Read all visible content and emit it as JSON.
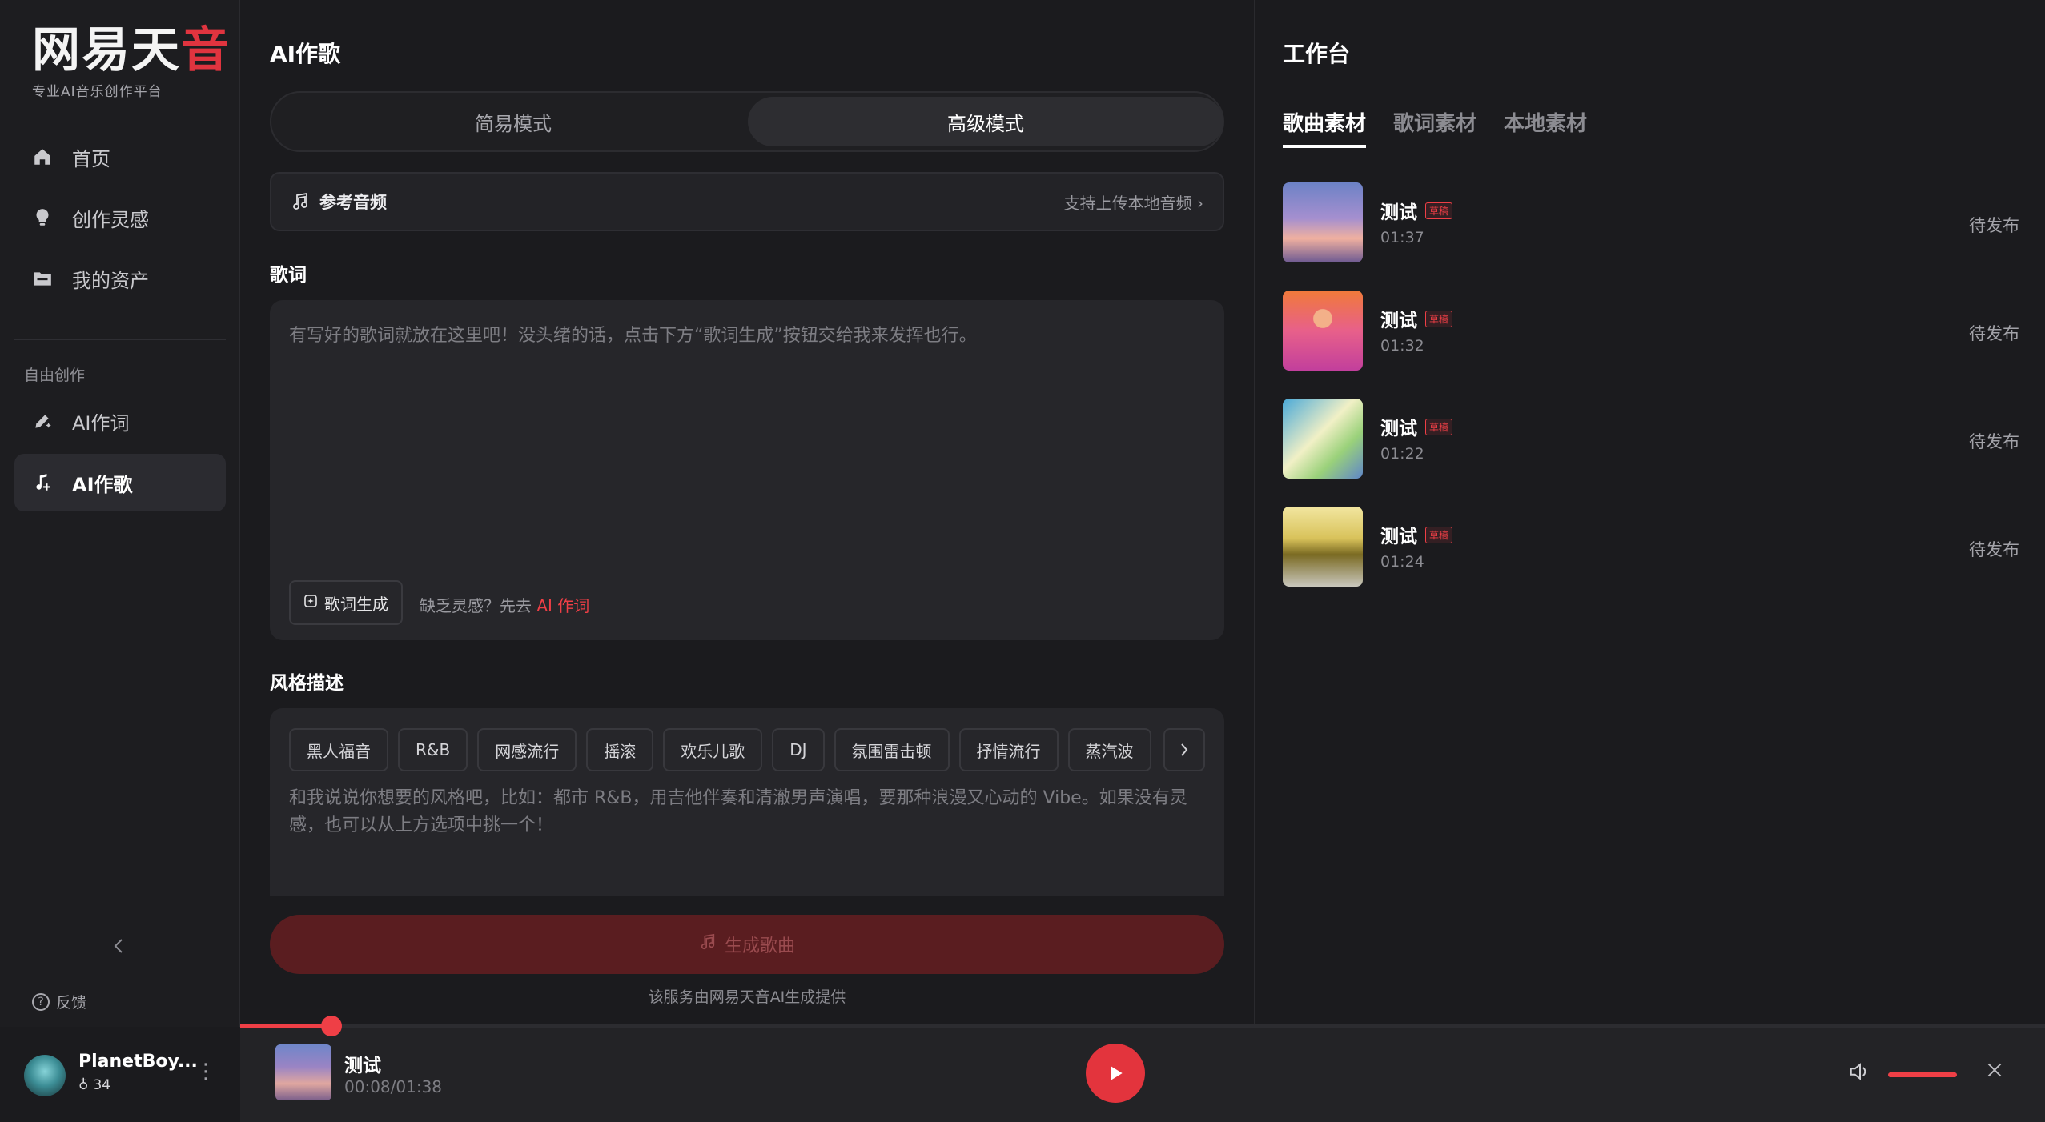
{
  "brand": {
    "logo_text": "网易天音",
    "tagline": "专业AI音乐创作平台"
  },
  "sidebar": {
    "nav": [
      {
        "label": "首页",
        "icon": "home-icon"
      },
      {
        "label": "创作灵感",
        "icon": "lightbulb-icon"
      },
      {
        "label": "我的资产",
        "icon": "folder-icon"
      }
    ],
    "section_label": "自由创作",
    "tools": [
      {
        "label": "AI作词",
        "icon": "pen-sparkle-icon",
        "active": false
      },
      {
        "label": "AI作歌",
        "icon": "music-note-plus-icon",
        "active": true
      }
    ],
    "feedback_label": "反馈",
    "user": {
      "name": "PlanetBoy...",
      "points": "34"
    }
  },
  "main": {
    "title": "AI作歌",
    "modes": [
      "简易模式",
      "高级模式"
    ],
    "active_mode": "高级模式",
    "reference_audio": {
      "label": "参考音频",
      "hint": "支持上传本地音频"
    },
    "lyrics": {
      "title": "歌词",
      "placeholder": "有写好的歌词就放在这里吧！没头绪的话，点击下方“歌词生成”按钮交给我来发挥也行。",
      "generate_label": "歌词生成",
      "hint_prefix": "缺乏灵感？先去",
      "hint_link": "AI 作词"
    },
    "style": {
      "title": "风格描述",
      "chips": [
        "黑人福音",
        "R&B",
        "网感流行",
        "摇滚",
        "欢乐儿歌",
        "DJ",
        "氛围雷击顿",
        "抒情流行",
        "蒸汽波"
      ],
      "placeholder": "和我说说你想要的风格吧，比如：都市 R&B，用吉他伴奏和清澈男声演唱，要那种浪漫又心动的 Vibe。如果没有灵感，也可以从上方选项中挑一个！"
    },
    "generate_button": "生成歌曲",
    "footer_note": "该服务由网易天音AI生成提供"
  },
  "workspace": {
    "title": "工作台",
    "tabs": [
      "歌曲素材",
      "歌词素材",
      "本地素材"
    ],
    "active_tab": "歌曲素材",
    "songs": [
      {
        "title": "测试",
        "badge": "草稿",
        "duration": "01:37",
        "status": "待发布"
      },
      {
        "title": "测试",
        "badge": "草稿",
        "duration": "01:32",
        "status": "待发布"
      },
      {
        "title": "测试",
        "badge": "草稿",
        "duration": "01:22",
        "status": "待发布"
      },
      {
        "title": "测试",
        "badge": "草稿",
        "duration": "01:24",
        "status": "待发布"
      }
    ]
  },
  "player": {
    "title": "测试",
    "time": "00:08/01:38",
    "progress_fraction": 0.0505,
    "volume_fraction": 1.0
  },
  "colors": {
    "accent": "#ef3f46",
    "background": "#1b1b1e",
    "panel": "#26262a"
  }
}
